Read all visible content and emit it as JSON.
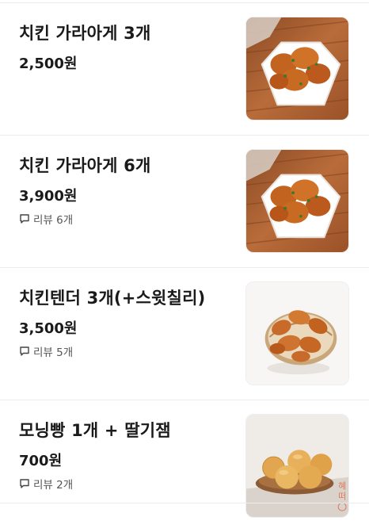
{
  "menu": {
    "items": [
      {
        "name": "치킨 가라아게 3개",
        "price": "2,500원",
        "review": "",
        "image_icon": "fried-chicken-on-wood-photo"
      },
      {
        "name": "치킨 가라아게 6개",
        "price": "3,900원",
        "review": "리뷰 6개",
        "image_icon": "fried-chicken-on-wood-photo"
      },
      {
        "name": "치킨텐더 3개(+스윗칠리)",
        "price": "3,500원",
        "review": "리뷰 5개",
        "image_icon": "chicken-tenders-basket-photo"
      },
      {
        "name": "모닝빵 1개 + 딸기잼",
        "price": "700원",
        "review": "리뷰 2개",
        "image_icon": "bread-rolls-plate-photo"
      }
    ]
  },
  "colors": {
    "text": "#1a1a1a",
    "subtext": "#555555",
    "divider": "#ececec",
    "wood": "#b5693a",
    "chicken": "#c86a2a"
  }
}
